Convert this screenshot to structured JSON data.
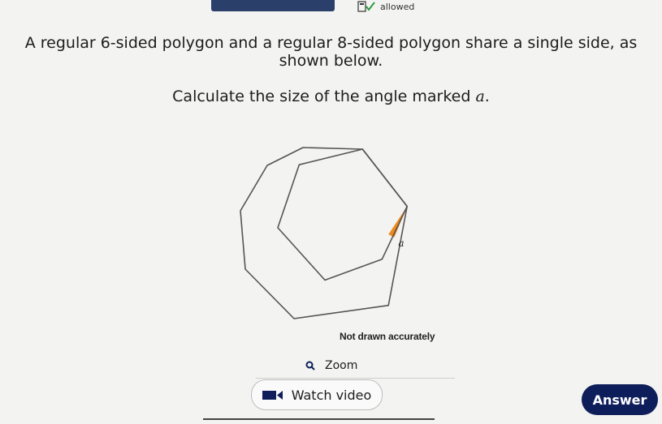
{
  "header": {
    "calculator_label": "allowed"
  },
  "question": {
    "line1": "A regular 6-sided polygon and a regular 8-sided polygon share a single side, as",
    "line2": "shown below.",
    "instruction_prefix": "Calculate the size of the angle marked ",
    "instruction_var": "a",
    "instruction_suffix": "."
  },
  "figure": {
    "angle_label": "a",
    "caption": "Not drawn accurately",
    "highlight_color": "#f08a1c"
  },
  "actions": {
    "zoom_label": "Zoom",
    "watch_label": "Watch video",
    "answer_label": "Answer"
  },
  "colors": {
    "answer_bg": "#0e1e5b",
    "top_bar": "#2a3f6a"
  }
}
